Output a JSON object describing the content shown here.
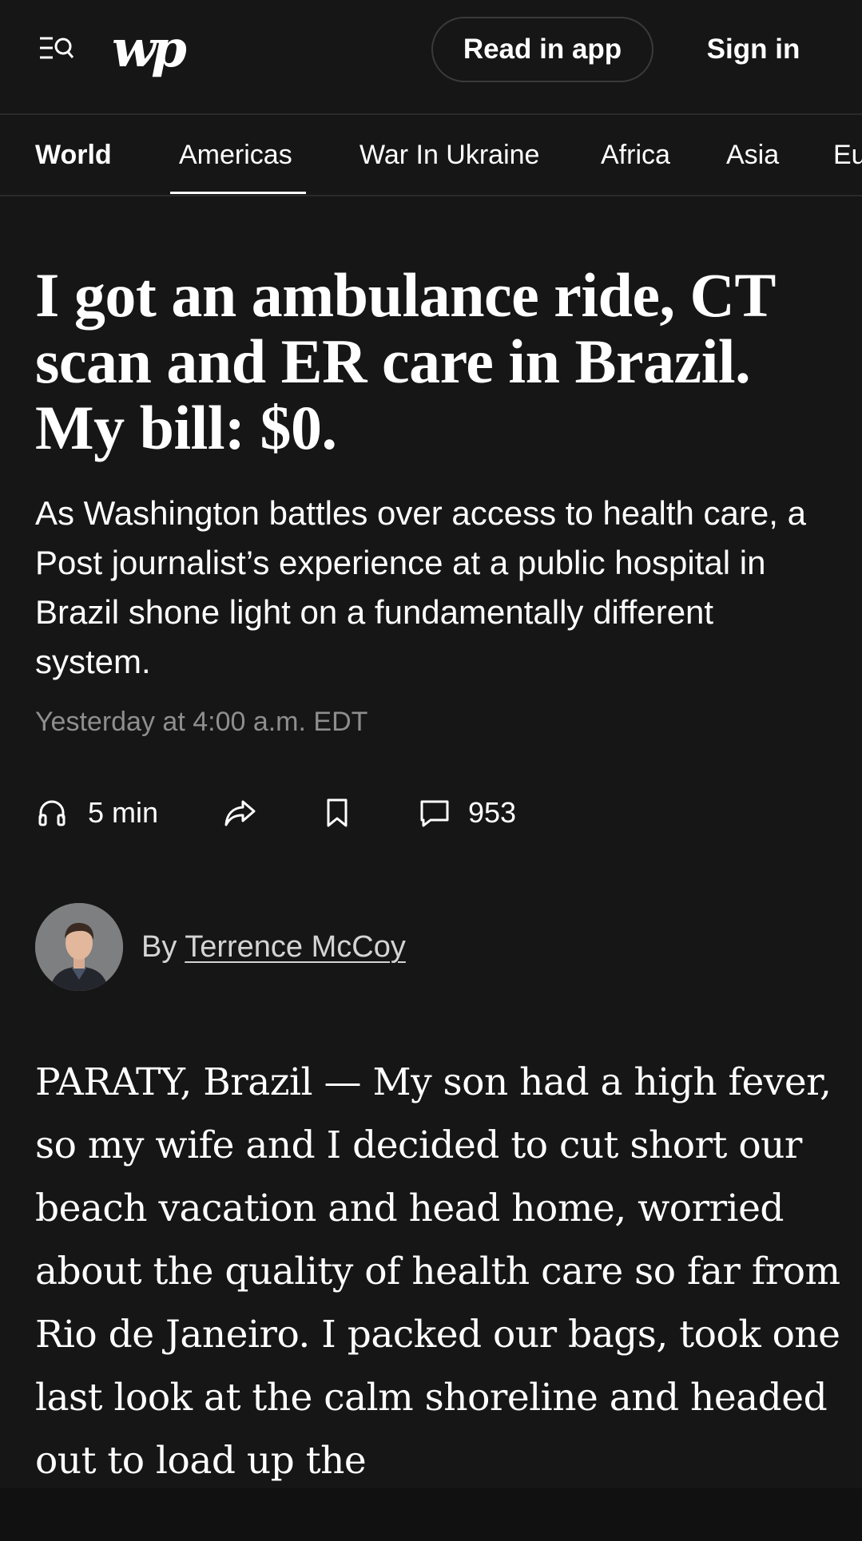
{
  "header": {
    "logo_text": "wp",
    "read_in_app_label": "Read in app",
    "sign_in_label": "Sign in"
  },
  "section_nav": {
    "items": [
      {
        "label": "World",
        "active_section": true
      },
      {
        "label": "Americas",
        "selected": true
      },
      {
        "label": "War In Ukraine"
      },
      {
        "label": "Africa"
      },
      {
        "label": "Asia"
      },
      {
        "label": "Eu"
      }
    ]
  },
  "article": {
    "headline": "I got an ambulance ride, CT scan and ER care in Brazil. My bill: $0.",
    "dek": "As Washington battles over access to health care, a Post journalist’s experience at a public hospital in Brazil shone light on a fundamentally different system.",
    "timestamp": "Yesterday at 4:00 a.m. EDT",
    "listen_label": "5 min",
    "comment_count": "953",
    "byline_prefix": "By ",
    "author": "Terrence McCoy",
    "body": "PARATY, Brazil — My son had a high fever, so my wife and I decided to cut short our beach vacation and head home, worried about the quality of health care so far from Rio de Janeiro. I packed our bags, took one last look at the calm shoreline and headed out to load up the"
  },
  "icons": {
    "menu": "menu-search-icon",
    "listen": "headphones-icon",
    "share": "share-icon",
    "save": "bookmark-icon",
    "comments": "comment-icon"
  },
  "colors": {
    "background": "#161616",
    "text": "#ffffff",
    "muted": "#8e8e8e",
    "divider": "#2a2a2a"
  }
}
